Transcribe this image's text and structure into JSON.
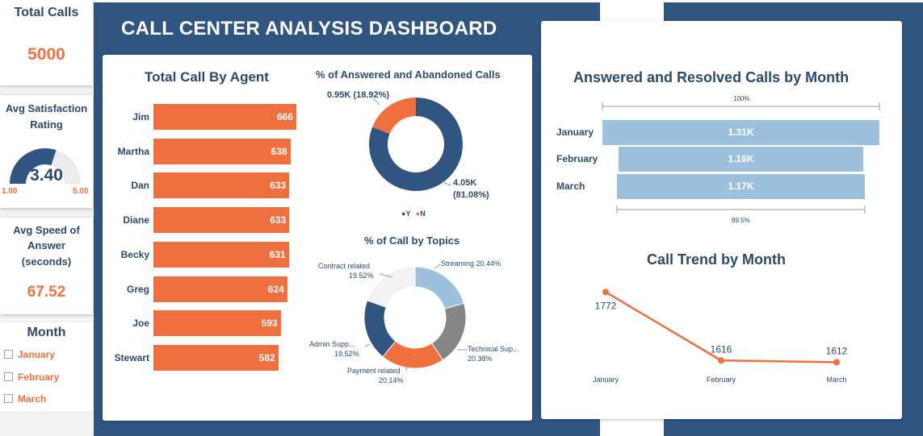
{
  "dashboard_title": "CALL CENTER ANALYSIS DASHBOARD",
  "kpis": {
    "total_calls": {
      "title": "Total Calls",
      "value": "5000"
    },
    "avg_satisfaction": {
      "title_line1": "Avg Satisfaction",
      "title_line2": "Rating",
      "value": "3.40",
      "min": "1.00",
      "max": "5.00",
      "fraction": 0.6
    },
    "avg_speed": {
      "title_line1": "Avg Speed of",
      "title_line2": "Answer",
      "title_line3": "(seconds)",
      "value": "67.52"
    }
  },
  "month_filter": {
    "title": "Month",
    "items": [
      "January",
      "February",
      "March"
    ]
  },
  "agents_chart": {
    "title": "Total Call By Agent",
    "agents": [
      {
        "name": "Jim",
        "calls": 666
      },
      {
        "name": "Martha",
        "calls": 638
      },
      {
        "name": "Dan",
        "calls": 633
      },
      {
        "name": "Diane",
        "calls": 633
      },
      {
        "name": "Becky",
        "calls": 631
      },
      {
        "name": "Greg",
        "calls": 624
      },
      {
        "name": "Joe",
        "calls": 593
      },
      {
        "name": "Stewart",
        "calls": 582
      }
    ]
  },
  "answered_chart": {
    "title": "% of Answered and Abandoned Calls",
    "abandoned_label": "0.95K (18.92%)",
    "answered_label_line1": "4.05K",
    "answered_label_line2": "(81.08%)",
    "legend_y": "Y",
    "legend_n": "N"
  },
  "topics_chart": {
    "title": "% of Call by Topics",
    "labels": {
      "streaming": "Streaming 20.44%",
      "technical_line1": "Technical Sup...",
      "technical_line2": "20.38%",
      "payment_line1": "Payment related",
      "payment_line2": "20.14%",
      "admin_line1": "Admin Supp...",
      "admin_line2": "19.52%",
      "contract_line1": "Contract related",
      "contract_line2": "19.52%"
    }
  },
  "funnel_chart": {
    "title": "Answered and Resolved Calls by Month",
    "top_pct": "100%",
    "bottom_pct": "89.5%",
    "rows": [
      {
        "month": "January",
        "value": "1.31K"
      },
      {
        "month": "February",
        "value": "1.16K"
      },
      {
        "month": "March",
        "value": "1.17K"
      }
    ]
  },
  "trend_chart": {
    "title": "Call Trend by Month",
    "colors": {
      "line": "#ef6f3f"
    }
  },
  "chart_data": [
    {
      "type": "bar",
      "title": "Total Call By Agent",
      "categories": [
        "Jim",
        "Martha",
        "Dan",
        "Diane",
        "Becky",
        "Greg",
        "Joe",
        "Stewart"
      ],
      "values": [
        666,
        638,
        633,
        633,
        631,
        624,
        593,
        582
      ]
    },
    {
      "type": "pie",
      "title": "% of Answered and Abandoned Calls",
      "categories": [
        "Y",
        "N"
      ],
      "values": [
        4050,
        950
      ],
      "percent": [
        81.08,
        18.92
      ],
      "colors": [
        "#2f5580",
        "#ef6f3f"
      ]
    },
    {
      "type": "pie",
      "title": "% of Call by Topics",
      "categories": [
        "Streaming",
        "Technical Sup...",
        "Payment related",
        "Admin Supp...",
        "Contract related"
      ],
      "values": [
        20.44,
        20.38,
        20.14,
        19.52,
        19.52
      ],
      "colors": [
        "#9dc1dc",
        "#858585",
        "#ef6f3f",
        "#2f5580",
        "#f2f2f2"
      ]
    },
    {
      "type": "bar",
      "title": "Answered and Resolved Calls by Month",
      "categories": [
        "January",
        "February",
        "March"
      ],
      "values": [
        1310,
        1160,
        1170
      ]
    },
    {
      "type": "line",
      "title": "Call Trend by Month",
      "categories": [
        "January",
        "February",
        "March"
      ],
      "values": [
        1772,
        1616,
        1612
      ]
    }
  ]
}
